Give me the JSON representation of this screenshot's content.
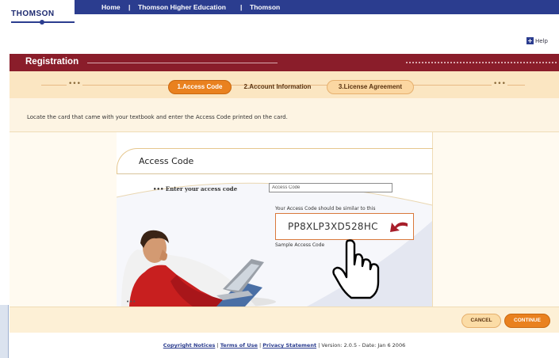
{
  "header": {
    "logo": "THOMSON",
    "nav": [
      "Home",
      "|",
      "Thomson Higher Education",
      "|",
      "Thomson"
    ],
    "help_label": "Help"
  },
  "section": {
    "title": "Registration"
  },
  "steps": [
    {
      "label": "1.Access Code",
      "state": "active"
    },
    {
      "label": "2.Account Information",
      "state": "inactive"
    },
    {
      "label": "3.License Agreement",
      "state": "inactive"
    }
  ],
  "steps_ellipsis": "•••",
  "instruction": "Locate the card that came with your textbook and enter the Access Code printed on the card.",
  "card": {
    "title": "Access Code",
    "enter_label": "••• Enter your access code",
    "input_value": "Access Code",
    "similar_text": "Your Access Code should be similar to this",
    "sample_code": "PP8XLP3XD528HC",
    "sample_label": "Sample Access Code",
    "ellipsis": "•••"
  },
  "buttons": {
    "cancel": "CANCEL",
    "continue": "CONTINUE"
  },
  "footer": {
    "copyright": "Copyright Notices",
    "terms": "Terms of Use",
    "privacy": "Privacy Statement",
    "version": "Version: 2.0.5 - Date: Jan 6 2006",
    "sep": "|"
  },
  "colors": {
    "nav_blue": "#2b3d8f",
    "reg_maroon": "#8a1d2a",
    "accent_orange": "#e9811f",
    "band_peach": "#fbe6c2"
  }
}
